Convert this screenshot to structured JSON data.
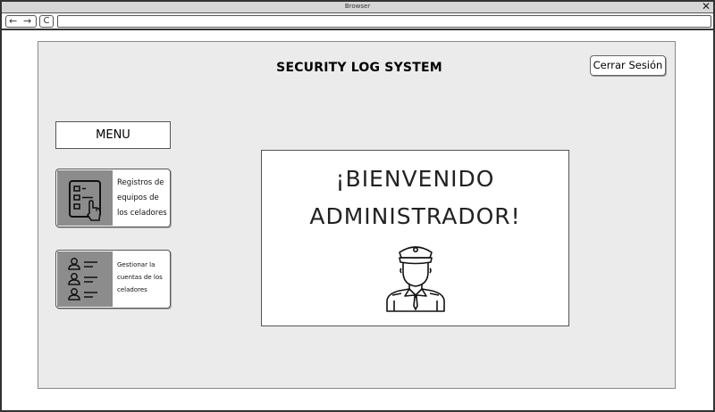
{
  "browser": {
    "window_title": "Browser",
    "close_glyph": "✕",
    "back_glyph": "←",
    "forward_glyph": "→",
    "reload_glyph": "C"
  },
  "header": {
    "title": "SECURITY LOG SYSTEM",
    "logout_label": "Cerrar Sesión"
  },
  "sidebar": {
    "menu_label": "MENU",
    "items": [
      {
        "label_lines": [
          "Registros de",
          "equipos de",
          "los celadores"
        ],
        "icon": "checklist-hand-icon"
      },
      {
        "label_lines": [
          "Gestionar la",
          "cuentas de los",
          "celadores"
        ],
        "icon": "user-list-icon"
      }
    ]
  },
  "main": {
    "welcome_line_1": "¡BIENVENIDO",
    "welcome_line_2": "ADMINISTRADOR!",
    "illustration": "police-officer-icon"
  },
  "colors": {
    "panel_bg": "#ebebeb",
    "card_icon_bg": "#8c8c8c",
    "titlebar_bg": "#d6d6d6"
  }
}
